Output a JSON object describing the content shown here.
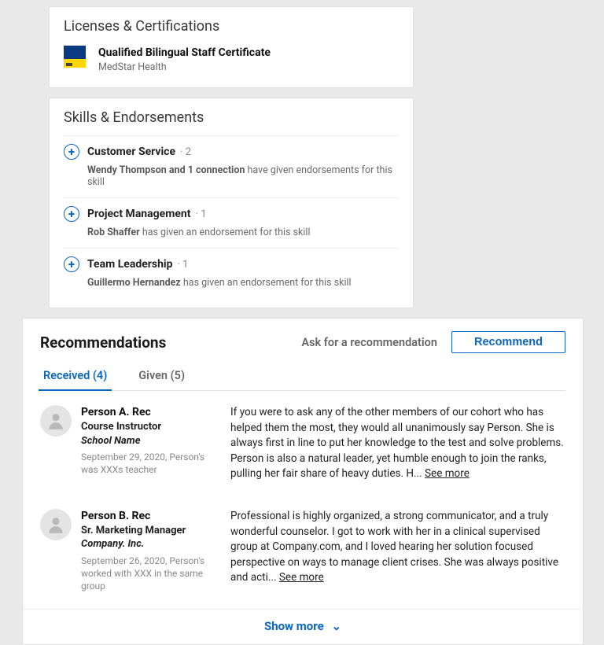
{
  "licenses": {
    "title": "Licenses & Certifications",
    "items": [
      {
        "title": "Qualified Bilingual Staff Certificate",
        "org": "MedStar Health"
      }
    ]
  },
  "skills": {
    "title": "Skills & Endorsements",
    "items": [
      {
        "name": "Customer Service",
        "count": "· 2",
        "endorser": "Wendy Thompson and 1 connection",
        "tail": " have given endorsements for this skill"
      },
      {
        "name": "Project Management",
        "count": "· 1",
        "endorser": "Rob Shaffer",
        "tail": " has given an endorsement for this skill"
      },
      {
        "name": "Team Leadership",
        "count": "· 1",
        "endorser": "Guillermo Hernandez",
        "tail": " has given an endorsement for this skill"
      }
    ]
  },
  "recs": {
    "title": "Recommendations",
    "ask": "Ask for a recommendation",
    "recommend": "Recommend",
    "tabs": {
      "received": "Received (4)",
      "given": "Given (5)"
    },
    "items": [
      {
        "name": "Person A. Rec",
        "role": "Course Instructor",
        "company": "School Name",
        "sub": "September 29, 2020, Person's was   XXXs   teacher",
        "body": "If you were to ask any of the other members of our cohort who has helped them the most, they would all unanimously say Person. She is always first in line to put her knowledge to the test and solve problems. Person is also a natural leader, yet humble enough to join the ranks, pulling her fair share of heavy duties. H... ",
        "see_more": "See more"
      },
      {
        "name": "Person B. Rec",
        "role": "Sr. Marketing Manager",
        "company": "Company. Inc.",
        "sub": "September 26, 2020, Person's worked with XXX  in the same group",
        "body": "Professional is highly organized, a strong communicator, and a truly wonderful counselor.  I got to work with her in a clinical supervised group at Company.com, and I loved hearing her solution focused perspective on ways to manage client crises. She  was always positive and acti... ",
        "see_more": "See more"
      }
    ],
    "show_more": "Show more"
  }
}
